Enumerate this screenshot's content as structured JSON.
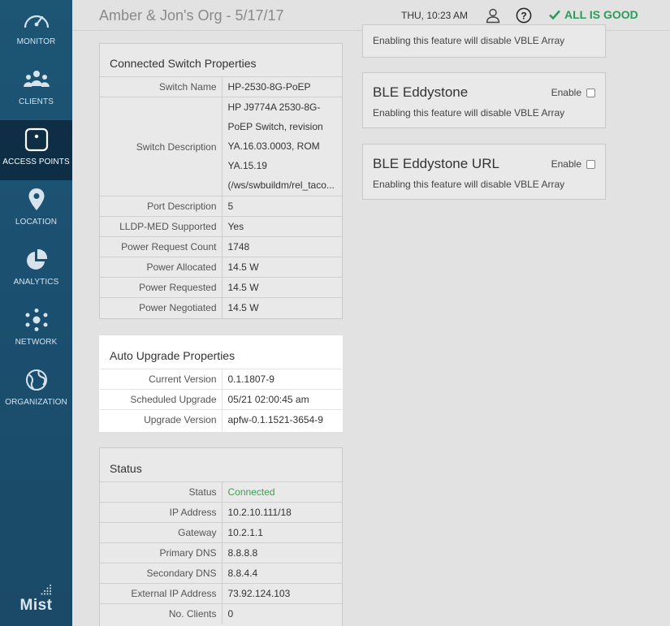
{
  "sidebar": {
    "items": [
      {
        "label": "MONITOR",
        "icon": "gauge-icon"
      },
      {
        "label": "CLIENTS",
        "icon": "users-icon"
      },
      {
        "label": "ACCESS POINTS",
        "icon": "access-point-icon",
        "active": true
      },
      {
        "label": "LOCATION",
        "icon": "map-pin-icon"
      },
      {
        "label": "ANALYTICS",
        "icon": "pie-chart-icon"
      },
      {
        "label": "NETWORK",
        "icon": "network-icon"
      },
      {
        "label": "ORGANIZATION",
        "icon": "globe-icon"
      }
    ],
    "brand": "Mist"
  },
  "header": {
    "title": "Amber & Jon's Org - 5/17/17",
    "datetime": "THU, 10:23 AM",
    "status": "ALL IS GOOD",
    "status_color": "#2e9b5a"
  },
  "switch_props": {
    "title": "Connected Switch Properties",
    "switch_name_label": "Switch Name",
    "switch_name": "HP-2530-8G-PoEP",
    "switch_desc_label": "Switch Description",
    "switch_desc_lines": [
      "HP J9774A 2530-8G-",
      "PoEP Switch, revision",
      "YA.16.03.0003, ROM",
      "YA.15.19",
      "(/ws/swbuildm/rel_taco..."
    ],
    "rows": [
      {
        "label": "Port Description",
        "value": "5"
      },
      {
        "label": "LLDP-MED Supported",
        "value": "Yes"
      },
      {
        "label": "Power Request Count",
        "value": "1748"
      },
      {
        "label": "Power Allocated",
        "value": "14.5 W"
      },
      {
        "label": "Power Requested",
        "value": "14.5 W"
      },
      {
        "label": "Power Negotiated",
        "value": "14.5 W"
      }
    ]
  },
  "upgrade_props": {
    "title": "Auto Upgrade Properties",
    "rows": [
      {
        "label": "Current Version",
        "value": "0.1.1807-9"
      },
      {
        "label": "Scheduled Upgrade",
        "value": "05/21 02:00:45 am"
      },
      {
        "label": "Upgrade Version",
        "value": "apfw-0.1.1521-3654-9"
      }
    ]
  },
  "status_panel": {
    "title": "Status",
    "rows": [
      {
        "label": "Status",
        "value": "Connected"
      },
      {
        "label": "IP Address",
        "value": "10.2.10.111/18"
      },
      {
        "label": "Gateway",
        "value": "10.2.1.1"
      },
      {
        "label": "Primary DNS",
        "value": "8.8.8.8"
      },
      {
        "label": "Secondary DNS",
        "value": "8.8.4.4"
      },
      {
        "label": "External IP Address",
        "value": "73.92.124.103"
      },
      {
        "label": "No. Clients",
        "value": "0"
      }
    ]
  },
  "features": {
    "top_partial_desc": "Enabling this feature will disable VBLE Array",
    "items": [
      {
        "title": "BLE Eddystone",
        "enable_label": "Enable",
        "desc": "Enabling this feature will disable VBLE Array",
        "checked": false
      },
      {
        "title": "BLE Eddystone URL",
        "enable_label": "Enable",
        "desc": "Enabling this feature will disable VBLE Array",
        "checked": false
      }
    ]
  }
}
